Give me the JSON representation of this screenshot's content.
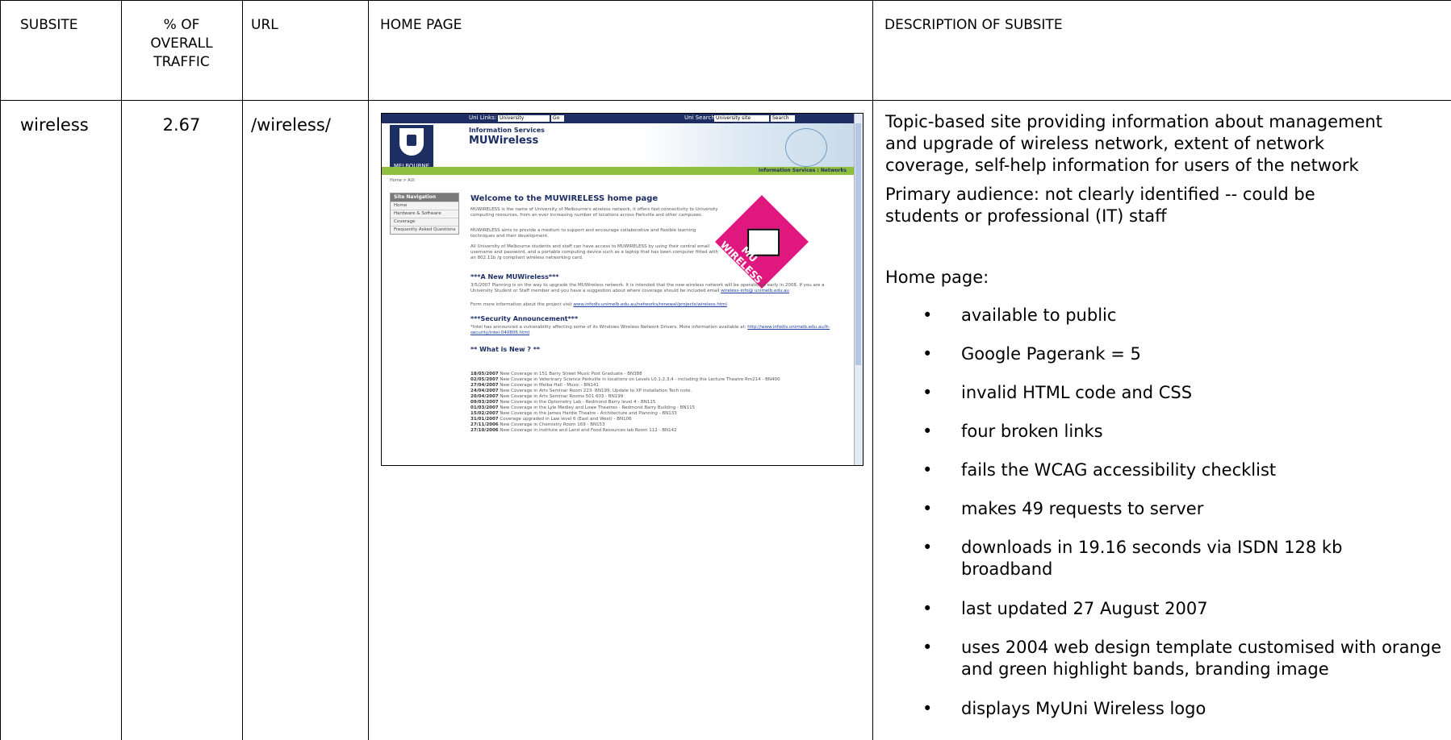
{
  "headers": {
    "subsite": "SUBSITE",
    "traffic": [
      "% OF",
      "OVERALL",
      "TRAFFIC"
    ],
    "url": "URL",
    "home_page": "HOME PAGE",
    "description": "DESCRIPTION OF SUBSITE"
  },
  "row": {
    "subsite": "wireless",
    "traffic": "2.67",
    "url": "/wireless/",
    "description_lines": [
      "Topic-based site providing information about management",
      "and upgrade of wireless network, extent of network",
      "coverage, self-help information for users of the network"
    ],
    "audience_lines": [
      "Primary audience: not clearly identified -- could be",
      "students or professional (IT) staff"
    ],
    "home_page_label": "Home page:",
    "bullets": [
      "available to public",
      "Google Pagerank = 5",
      "invalid HTML code and CSS",
      "four broken links",
      "fails the WCAG accessibility checklist",
      "makes 49 requests to server",
      "downloads in 19.16 seconds via ISDN 128 kb broadband",
      "last updated 27 August 2007",
      "uses 2004 web design template customised with orange and green highlight bands, branding image",
      "displays MyUni Wireless logo"
    ]
  },
  "screenshot": {
    "uni_links_label": "Uni Links:",
    "uni_links_select": "University Homepage",
    "go_button": "Go",
    "uni_search_label": "Uni Search:",
    "uni_search_box": "University site search",
    "search_button": "Search",
    "logo_text": "MELBOURNE",
    "info_services": "Information Services",
    "site_title": "MUWireless",
    "band_text": "Information Services : Networks",
    "breadcrumb": "Home > AUI",
    "nav_heading": "Site Navigation",
    "nav_items": [
      "Home",
      "Hardware & Software",
      "Coverage",
      "Frequently Asked Questions"
    ],
    "welcome": "Welcome to the MUWIRELESS home page",
    "para1": "MUWIRELESS is the name of University of Melbourne's wireless network, it offers fast connectivity to University computing resources, from an ever increasing number of locations across Parkville and other campuses.",
    "para2": "MUWIRELESS aims to provide a medium to support and encourage collaborative and flexible learning techniques and their development.",
    "para3": "All University of Melbourne students and staff can have access to MUWIRELESS by using their central email username and password, and a portable computing device such as a laptop that has been computer fitted with an 802.11b /g compliant wireless networking card.",
    "new_heading": "***A New MUWireless***",
    "new_para": "3/5/2007 Planning is on the way to upgrade the MUWireless network. It is intended that the new wireless network will be operational early in 2008. If you are a University Student or Staff member and you have a suggestion about where coverage should be included email",
    "new_email": "wireless-info@ unimelb.edu.au",
    "more_info": "Form more information about the project visit",
    "more_link": "www.infodiv.unimelb.edu.au/networks/renewal/projects/wireless.html",
    "security_heading": "***Security Announcement***",
    "security_para": "*Intel has announced a vulnerability affecting some of its Windows Wireless Network Drivers. More information available at:",
    "security_link": "http://www.infodiv.unimelb.edu.au/it-security/intel-040806.html",
    "whats_new": "** What is New ? **",
    "badge_text": "MU WIRELESS",
    "updates": [
      {
        "date": "18/05/2007",
        "text": "New Coverage in 151 Barry Street Music Post Graduate - BN388"
      },
      {
        "date": "02/05/2007",
        "text": "New Coverage in Veterinary Science Parkville in locations on Levels L0,1,2,3,4 - including the Lecture Theatre Rm214 - BN400"
      },
      {
        "date": "27/04/2007",
        "text": "New Coverage in Melba Hall - Music - BN141"
      },
      {
        "date": "24/04/2007",
        "text": "New Coverage in Arts Seminar Room 223- BN199, Update to XP installation Tech note."
      },
      {
        "date": "20/04/2007",
        "text": "New Coverage in Arts Seminar Rooms 501 603 - BN199"
      },
      {
        "date": "09/03/2007",
        "text": "New Coverage in the Optometry Lab - Redmond Barry level 4 - BN115"
      },
      {
        "date": "01/03/2007",
        "text": "New Coverage in the Lyle Medley and Lowe Theatres - Redmond Barry Building - BN115"
      },
      {
        "date": "15/02/2007",
        "text": "New Coverage in the James Hardie Theatre - Architecture and Planning - BN133"
      },
      {
        "date": "31/01/2007",
        "text": "Coverage upgraded in Law level 6 (East and West) - BN106"
      },
      {
        "date": "27/11/2006",
        "text": "New Coverage in Chemistry Room 169 - BN153"
      },
      {
        "date": "27/10/2006",
        "text": "New Coverage in Institute and Land and Food Resources lab Room 112 - BN142"
      }
    ]
  }
}
